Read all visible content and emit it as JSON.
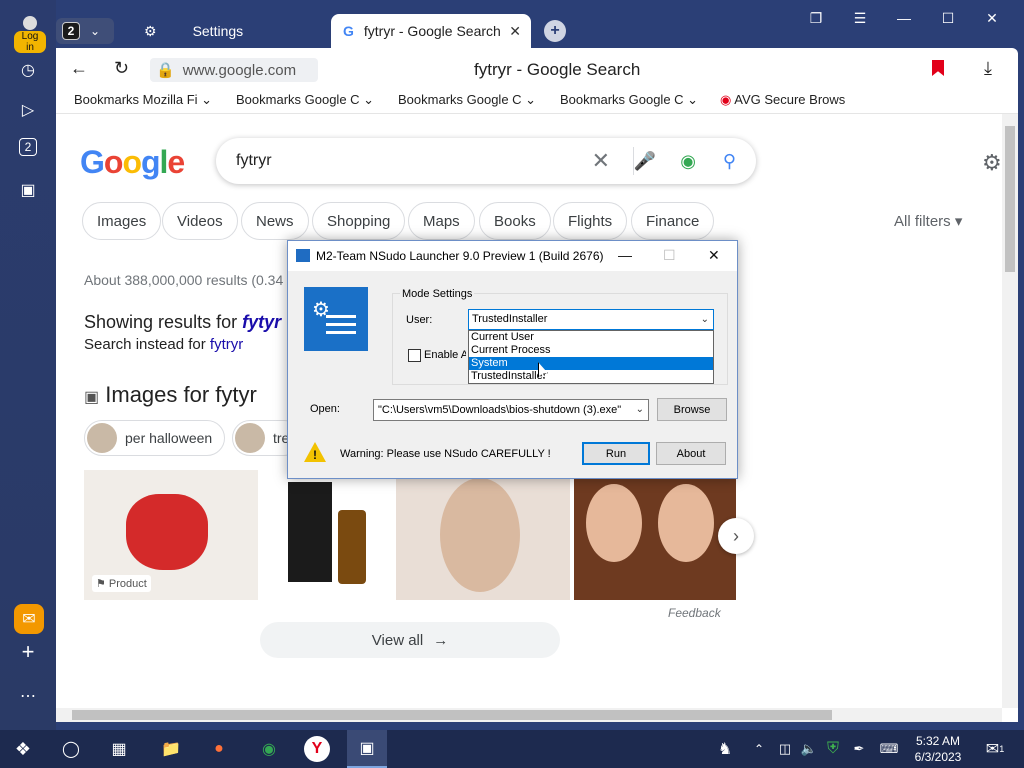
{
  "browser": {
    "avatar_label": "Log in",
    "tab_count": "2",
    "tabs": [
      {
        "label": "Settings",
        "icon": "gear-icon"
      },
      {
        "label": "fytryr - Google Search",
        "icon": "google-icon"
      }
    ],
    "url": "www.google.com",
    "page_title": "fytryr - Google Search",
    "bookmarks": [
      "Bookmarks Mozilla Fi",
      "Bookmarks Google C",
      "Bookmarks Google C",
      "Bookmarks Google C",
      "AVG Secure Brows"
    ],
    "rail_badge": "2"
  },
  "google": {
    "logo": "Google",
    "query": "fytryr",
    "chips": [
      "Images",
      "Videos",
      "News",
      "Shopping",
      "Maps",
      "Books",
      "Flights",
      "Finance"
    ],
    "all_filters": "All filters",
    "results_count": "About 388,000,000 results (0.34",
    "showing_prefix": "Showing results for ",
    "showing_term": "fytyr",
    "instead_prefix": "Search instead for ",
    "instead_term": "fytryr",
    "images_heading": "Images for fytyr",
    "pill_chips": [
      "per halloween",
      "tre"
    ],
    "product_tag": "Product",
    "feedback": "Feedback",
    "view_all": "View all"
  },
  "dialog": {
    "title": "M2-Team NSudo Launcher 9.0 Preview 1 (Build 2676)",
    "mode_settings": "Mode Settings",
    "user_label": "User:",
    "user_value": "TrustedInstaller",
    "user_options": [
      "Current User",
      "Current Process",
      "System",
      "TrustedInstaller"
    ],
    "highlighted_option": "System",
    "enable_label": "Enable Al",
    "open_label": "Open:",
    "open_value": "\"C:\\Users\\vm5\\Downloads\\bios-shutdown (3).exe\"",
    "browse": "Browse",
    "warning": "Warning: Please use NSudo CAREFULLY !",
    "run": "Run",
    "about": "About"
  },
  "taskbar": {
    "time": "5:32 AM",
    "date": "6/3/2023",
    "notification_count": "1"
  }
}
